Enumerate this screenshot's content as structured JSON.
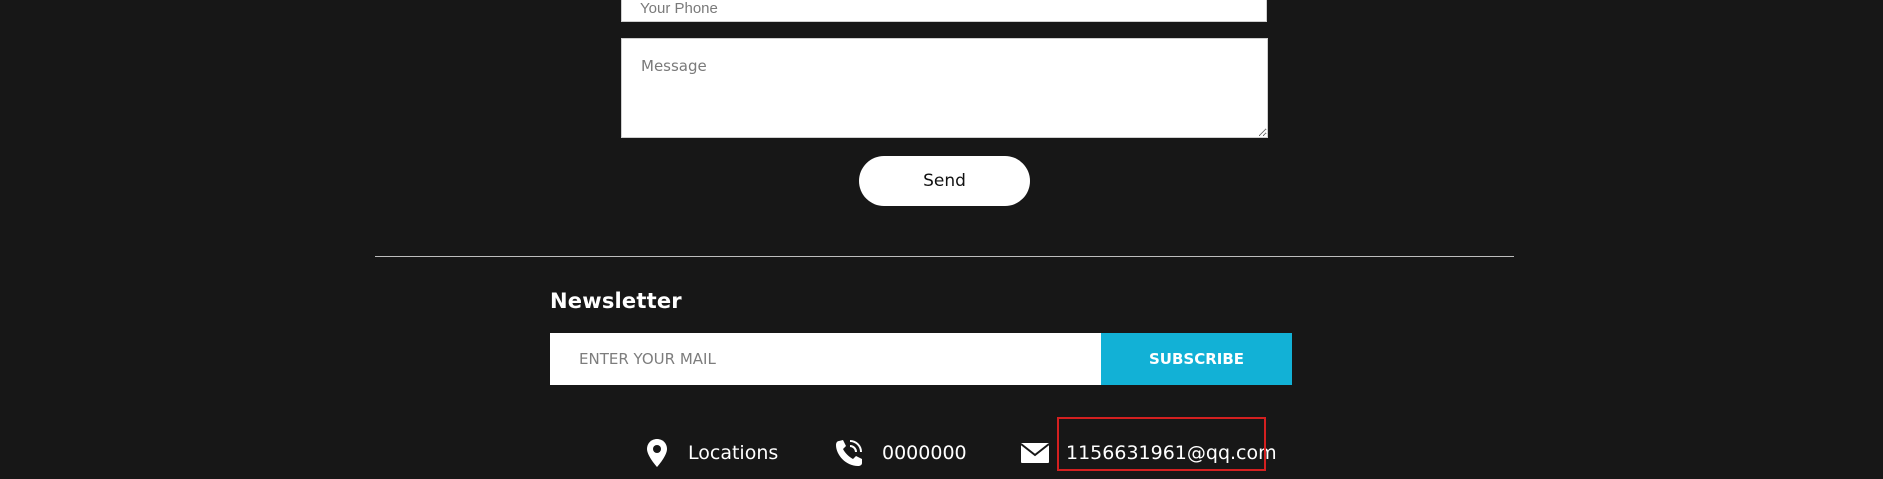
{
  "form": {
    "phone_placeholder": "Your Phone",
    "message_placeholder": "Message",
    "send_label": "Send"
  },
  "newsletter": {
    "title": "Newsletter",
    "input_placeholder": "ENTER YOUR MAIL",
    "subscribe_label": "SUBSCRIBE"
  },
  "contact": {
    "location_label": "Locations",
    "location_icon": "location-pin-icon",
    "phone_number": "0000000",
    "phone_icon": "phone-icon",
    "email": "1156631961@qq.com",
    "email_icon": "envelope-icon"
  },
  "colors": {
    "background": "#171717",
    "accent": "#12b1d6",
    "highlight": "#d42020"
  }
}
